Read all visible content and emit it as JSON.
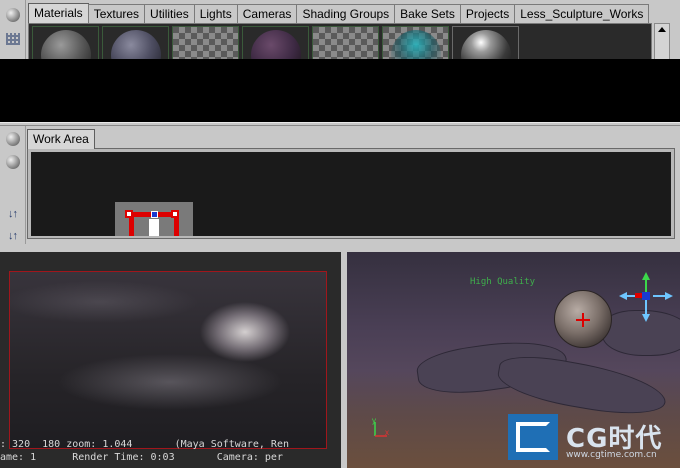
{
  "hypershade": {
    "tabs": [
      {
        "label": "Materials",
        "active": true
      },
      {
        "label": "Textures",
        "active": false
      },
      {
        "label": "Utilities",
        "active": false
      },
      {
        "label": "Lights",
        "active": false
      },
      {
        "label": "Cameras",
        "active": false
      },
      {
        "label": "Shading Groups",
        "active": false
      },
      {
        "label": "Bake Sets",
        "active": false
      },
      {
        "label": "Projects",
        "active": false
      },
      {
        "label": "Less_Sculpture_Works",
        "active": false
      }
    ],
    "work_area_tab": "Work Area"
  },
  "render_view": {
    "info_line": ": 320  180 zoom: 1.044       (Maya Software, Ren",
    "status_line": "ame: 1      Render Time: 0:03       Camera: per"
  },
  "viewport": {
    "label": "High Quality"
  },
  "watermark": {
    "brand": "CG时代",
    "url": "www.cgtime.com.cn"
  },
  "colors": {
    "accent_red": "#d00000",
    "viewport_text": "#3fae4c",
    "logo_blue": "#1f6fb5"
  }
}
